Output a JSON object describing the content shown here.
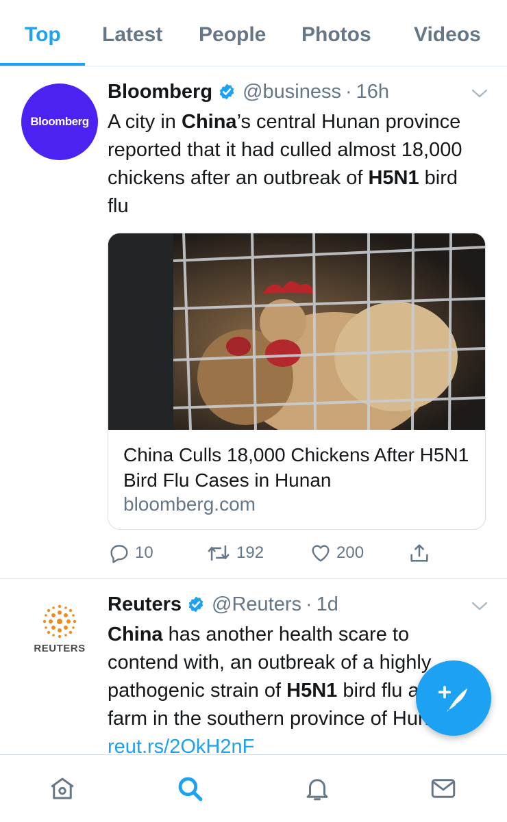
{
  "tabs": [
    {
      "label": "Top",
      "active": true
    },
    {
      "label": "Latest",
      "active": false
    },
    {
      "label": "People",
      "active": false
    },
    {
      "label": "Photos",
      "active": false
    },
    {
      "label": "Videos",
      "active": false
    }
  ],
  "colors": {
    "accent": "#1da1f2",
    "muted": "#657786",
    "bloomberg_avatar": "#4c22f2",
    "reuters_orange": "#f08c1e"
  },
  "tweets": [
    {
      "avatar_text": "Bloomberg",
      "name": "Bloomberg",
      "handle": "@business",
      "time": "16h",
      "text_parts": [
        {
          "t": "A city in ",
          "bold": false
        },
        {
          "t": "China",
          "bold": true
        },
        {
          "t": "’s central Hunan province reported that it had culled almost 18,000 chickens after an outbreak of ",
          "bold": false
        },
        {
          "t": "H5N1",
          "bold": true
        },
        {
          "t": " bird flu",
          "bold": false
        }
      ],
      "card": {
        "image_desc_icon": "chicken-cage-photo",
        "title": "China Culls 18,000 Chickens After H5N1 Bird Flu Cases in Hunan",
        "domain": "bloomberg.com"
      },
      "replies": "10",
      "retweets": "192",
      "likes": "200"
    },
    {
      "avatar_text": "REUTERS",
      "name": "Reuters",
      "handle": "@Reuters",
      "time": "1d",
      "text_parts": [
        {
          "t": "China",
          "bold": true
        },
        {
          "t": " has another health scare to contend with, an outbreak of a highly pathogenic strain of ",
          "bold": false
        },
        {
          "t": "H5N1",
          "bold": true
        },
        {
          "t": " bird flu at a farm in the southern province of Hunan ",
          "bold": false
        }
      ],
      "link": "reut.rs/2OkH2nF"
    }
  ],
  "bottom_nav": [
    {
      "icon": "home-icon"
    },
    {
      "icon": "search-icon",
      "active": true
    },
    {
      "icon": "notifications-icon"
    },
    {
      "icon": "messages-icon"
    }
  ],
  "fab_icon": "compose-tweet-icon"
}
